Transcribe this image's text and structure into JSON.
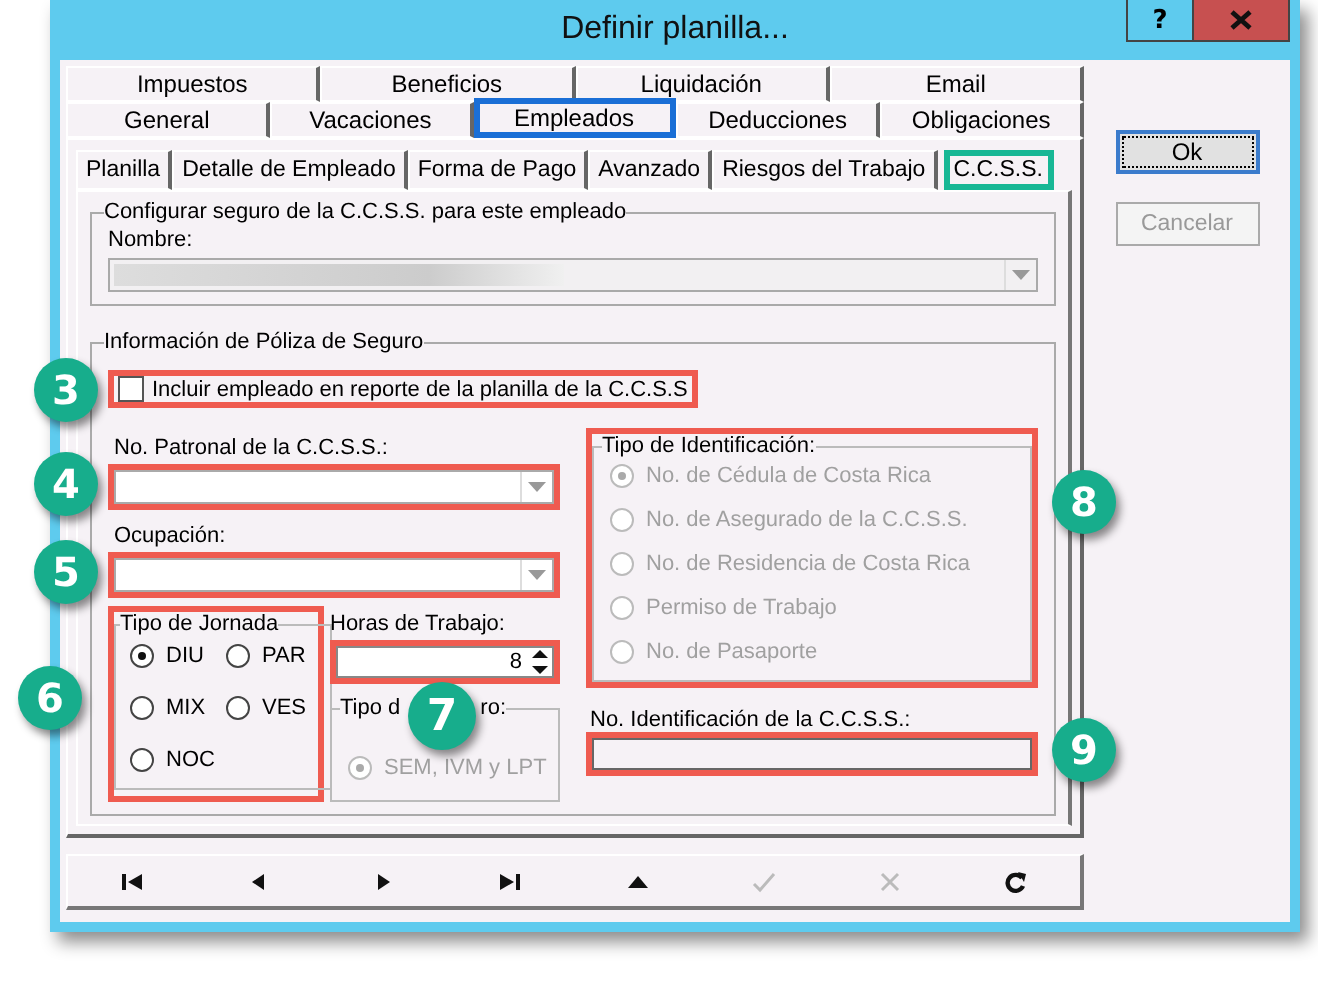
{
  "window": {
    "title": "Definir planilla...",
    "help_button": "?"
  },
  "tab_rows": [
    [
      {
        "label": "Impuestos",
        "selected": false
      },
      {
        "label": "Beneficios",
        "selected": false
      },
      {
        "label": "Liquidación",
        "selected": false
      },
      {
        "label": "Email",
        "selected": false
      }
    ],
    [
      {
        "label": "General",
        "selected": false
      },
      {
        "label": "Vacaciones",
        "selected": false
      },
      {
        "label": "Empleados",
        "selected": true
      },
      {
        "label": "Deducciones",
        "selected": false
      },
      {
        "label": "Obligaciones",
        "selected": false
      }
    ]
  ],
  "subtabs": [
    {
      "label": "Planilla",
      "selected": false
    },
    {
      "label": "Detalle de Empleado",
      "selected": false
    },
    {
      "label": "Forma de Pago",
      "selected": false
    },
    {
      "label": "Avanzado",
      "selected": false
    },
    {
      "label": "Riesgos del Trabajo",
      "selected": false
    },
    {
      "label": "C.C.S.S.",
      "selected": true
    }
  ],
  "insurance_group": {
    "legend": "Configurar seguro de la C.C.S.S. para este empleado",
    "name_label": "Nombre:",
    "name_disabled": true,
    "name_redacted": true
  },
  "policy_group": {
    "legend": "Información de Póliza de Seguro",
    "include_checkbox": {
      "label": "Incluir empleado en reporte de la planilla de la C.C.S.S",
      "checked": false,
      "callout": "3"
    },
    "employer_number": {
      "label": "No. Patronal de la C.C.S.S.:",
      "callout": "4"
    },
    "occupation": {
      "label": "Ocupación:",
      "callout": "5"
    },
    "workday_type": {
      "legend": "Tipo de Jornada",
      "callout": "6",
      "options": [
        {
          "label": "DIU",
          "selected": true
        },
        {
          "label": "PAR",
          "selected": false
        },
        {
          "label": "MIX",
          "selected": false
        },
        {
          "label": "VES",
          "selected": false
        },
        {
          "label": "NOC",
          "selected": false
        }
      ]
    },
    "work_hours": {
      "label": "Horas de Trabajo:",
      "value": "8",
      "callout": "7"
    },
    "insurance_type": {
      "legend_parts": [
        "Tipo d",
        "ro:"
      ],
      "disabled": true,
      "options": [
        {
          "label": "SEM, IVM y LPT",
          "selected": true
        }
      ]
    },
    "id_type": {
      "legend": "Tipo de Identificación:",
      "disabled": true,
      "callout": "8",
      "options": [
        {
          "label": "No. de Cédula de Costa Rica",
          "selected": true
        },
        {
          "label": "No. de Asegurado de la C.C.S.S.",
          "selected": false
        },
        {
          "label": "No. de Residencia de Costa Rica",
          "selected": false
        },
        {
          "label": "Permiso de Trabajo",
          "selected": false
        },
        {
          "label": "No. de Pasaporte",
          "selected": false
        }
      ]
    },
    "id_number": {
      "label": "No. Identificación de la C.C.S.S.:",
      "callout": "9"
    }
  },
  "nav_buttons": [
    {
      "kind": "first",
      "disabled": false
    },
    {
      "kind": "prev",
      "disabled": false
    },
    {
      "kind": "next",
      "disabled": false
    },
    {
      "kind": "last",
      "disabled": false
    },
    {
      "kind": "up",
      "disabled": false
    },
    {
      "kind": "check",
      "disabled": true
    },
    {
      "kind": "cancel",
      "disabled": true
    },
    {
      "kind": "refresh",
      "disabled": false
    }
  ],
  "ok_button": {
    "label": "Ok",
    "default": true
  },
  "cancel_button": {
    "label": "Cancelar",
    "disabled": true
  }
}
